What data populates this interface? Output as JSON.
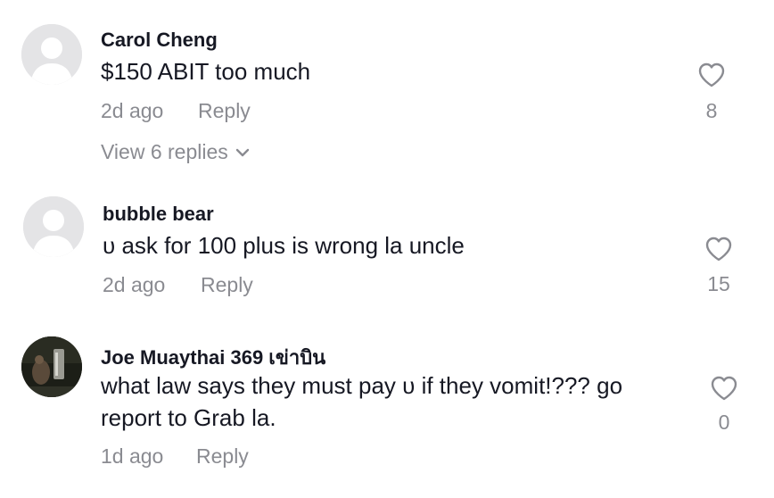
{
  "comments": [
    {
      "username": "Carol Cheng",
      "text": "$150 ABIT too much",
      "time": "2d ago",
      "reply_label": "Reply",
      "likes": "8",
      "avatar": "default-avatar-icon",
      "view_replies": "View 6 replies"
    },
    {
      "username": "bubble bear",
      "text": "ᴜ ask for 100 plus is wrong la uncle",
      "time": "2d ago",
      "reply_label": "Reply",
      "likes": "15",
      "avatar": "default-avatar-icon"
    },
    {
      "username": "Joe Muaythai 369 เข่าบิน",
      "text": "what law says they must pay ᴜ if they vomit!??? go report to Grab la.",
      "time": "1d ago",
      "reply_label": "Reply",
      "likes": "0",
      "avatar": "photo-avatar"
    }
  ],
  "colors": {
    "text_primary": "#161823",
    "text_secondary": "#8a8b91",
    "avatar_bg": "#d9d9dc"
  },
  "icons": {
    "like": "heart-outline-icon",
    "expand": "chevron-down-icon"
  }
}
